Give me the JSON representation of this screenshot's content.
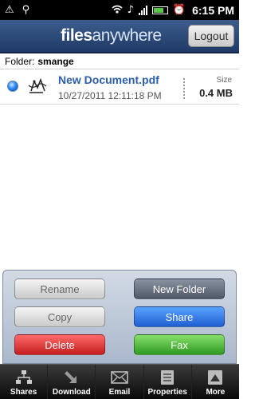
{
  "status_bar": {
    "time": "6:15",
    "time_suffix": "PM"
  },
  "header": {
    "logo_bold": "files",
    "logo_light": "anywhere",
    "logout_label": "Logout"
  },
  "folder": {
    "label": "Folder:",
    "value": "smange"
  },
  "files": [
    {
      "name": "New Document.pdf",
      "date": "10/27/2011 12:11:18 PM",
      "size_label": "Size",
      "size": "0.4 MB"
    }
  ],
  "actions": {
    "rename": "Rename",
    "new_folder": "New Folder",
    "copy": "Copy",
    "share": "Share",
    "delete": "Delete",
    "fax": "Fax"
  },
  "toolbar": {
    "items": [
      {
        "label": "Shares",
        "icon": "network-icon"
      },
      {
        "label": "Download",
        "icon": "download-icon"
      },
      {
        "label": "Email",
        "icon": "email-icon"
      },
      {
        "label": "Properties",
        "icon": "properties-icon"
      },
      {
        "label": "More",
        "icon": "more-icon"
      }
    ]
  },
  "colors": {
    "header": "#2b4a78",
    "file_name": "#2b5ea8",
    "share_button": "#2f74e6",
    "delete_button": "#d33030",
    "fax_button": "#44b02f"
  }
}
